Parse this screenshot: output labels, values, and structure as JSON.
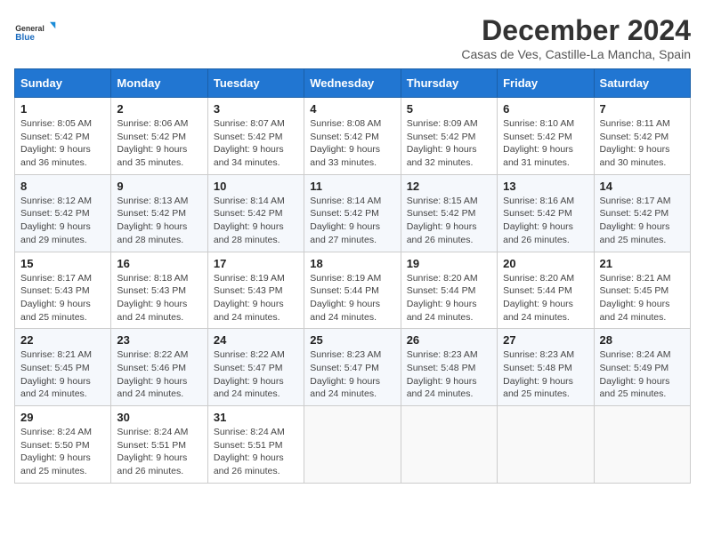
{
  "header": {
    "logo_line1": "General",
    "logo_line2": "Blue",
    "month_year": "December 2024",
    "location": "Casas de Ves, Castille-La Mancha, Spain"
  },
  "columns": [
    "Sunday",
    "Monday",
    "Tuesday",
    "Wednesday",
    "Thursday",
    "Friday",
    "Saturday"
  ],
  "weeks": [
    [
      {
        "day": "1",
        "sunrise": "8:05 AM",
        "sunset": "5:42 PM",
        "daylight": "9 hours and 36 minutes."
      },
      {
        "day": "2",
        "sunrise": "8:06 AM",
        "sunset": "5:42 PM",
        "daylight": "9 hours and 35 minutes."
      },
      {
        "day": "3",
        "sunrise": "8:07 AM",
        "sunset": "5:42 PM",
        "daylight": "9 hours and 34 minutes."
      },
      {
        "day": "4",
        "sunrise": "8:08 AM",
        "sunset": "5:42 PM",
        "daylight": "9 hours and 33 minutes."
      },
      {
        "day": "5",
        "sunrise": "8:09 AM",
        "sunset": "5:42 PM",
        "daylight": "9 hours and 32 minutes."
      },
      {
        "day": "6",
        "sunrise": "8:10 AM",
        "sunset": "5:42 PM",
        "daylight": "9 hours and 31 minutes."
      },
      {
        "day": "7",
        "sunrise": "8:11 AM",
        "sunset": "5:42 PM",
        "daylight": "9 hours and 30 minutes."
      }
    ],
    [
      {
        "day": "8",
        "sunrise": "8:12 AM",
        "sunset": "5:42 PM",
        "daylight": "9 hours and 29 minutes."
      },
      {
        "day": "9",
        "sunrise": "8:13 AM",
        "sunset": "5:42 PM",
        "daylight": "9 hours and 28 minutes."
      },
      {
        "day": "10",
        "sunrise": "8:14 AM",
        "sunset": "5:42 PM",
        "daylight": "9 hours and 28 minutes."
      },
      {
        "day": "11",
        "sunrise": "8:14 AM",
        "sunset": "5:42 PM",
        "daylight": "9 hours and 27 minutes."
      },
      {
        "day": "12",
        "sunrise": "8:15 AM",
        "sunset": "5:42 PM",
        "daylight": "9 hours and 26 minutes."
      },
      {
        "day": "13",
        "sunrise": "8:16 AM",
        "sunset": "5:42 PM",
        "daylight": "9 hours and 26 minutes."
      },
      {
        "day": "14",
        "sunrise": "8:17 AM",
        "sunset": "5:42 PM",
        "daylight": "9 hours and 25 minutes."
      }
    ],
    [
      {
        "day": "15",
        "sunrise": "8:17 AM",
        "sunset": "5:43 PM",
        "daylight": "9 hours and 25 minutes."
      },
      {
        "day": "16",
        "sunrise": "8:18 AM",
        "sunset": "5:43 PM",
        "daylight": "9 hours and 24 minutes."
      },
      {
        "day": "17",
        "sunrise": "8:19 AM",
        "sunset": "5:43 PM",
        "daylight": "9 hours and 24 minutes."
      },
      {
        "day": "18",
        "sunrise": "8:19 AM",
        "sunset": "5:44 PM",
        "daylight": "9 hours and 24 minutes."
      },
      {
        "day": "19",
        "sunrise": "8:20 AM",
        "sunset": "5:44 PM",
        "daylight": "9 hours and 24 minutes."
      },
      {
        "day": "20",
        "sunrise": "8:20 AM",
        "sunset": "5:44 PM",
        "daylight": "9 hours and 24 minutes."
      },
      {
        "day": "21",
        "sunrise": "8:21 AM",
        "sunset": "5:45 PM",
        "daylight": "9 hours and 24 minutes."
      }
    ],
    [
      {
        "day": "22",
        "sunrise": "8:21 AM",
        "sunset": "5:45 PM",
        "daylight": "9 hours and 24 minutes."
      },
      {
        "day": "23",
        "sunrise": "8:22 AM",
        "sunset": "5:46 PM",
        "daylight": "9 hours and 24 minutes."
      },
      {
        "day": "24",
        "sunrise": "8:22 AM",
        "sunset": "5:47 PM",
        "daylight": "9 hours and 24 minutes."
      },
      {
        "day": "25",
        "sunrise": "8:23 AM",
        "sunset": "5:47 PM",
        "daylight": "9 hours and 24 minutes."
      },
      {
        "day": "26",
        "sunrise": "8:23 AM",
        "sunset": "5:48 PM",
        "daylight": "9 hours and 24 minutes."
      },
      {
        "day": "27",
        "sunrise": "8:23 AM",
        "sunset": "5:48 PM",
        "daylight": "9 hours and 25 minutes."
      },
      {
        "day": "28",
        "sunrise": "8:24 AM",
        "sunset": "5:49 PM",
        "daylight": "9 hours and 25 minutes."
      }
    ],
    [
      {
        "day": "29",
        "sunrise": "8:24 AM",
        "sunset": "5:50 PM",
        "daylight": "9 hours and 25 minutes."
      },
      {
        "day": "30",
        "sunrise": "8:24 AM",
        "sunset": "5:51 PM",
        "daylight": "9 hours and 26 minutes."
      },
      {
        "day": "31",
        "sunrise": "8:24 AM",
        "sunset": "5:51 PM",
        "daylight": "9 hours and 26 minutes."
      },
      null,
      null,
      null,
      null
    ]
  ],
  "labels": {
    "sunrise": "Sunrise:",
    "sunset": "Sunset:",
    "daylight": "Daylight:"
  }
}
